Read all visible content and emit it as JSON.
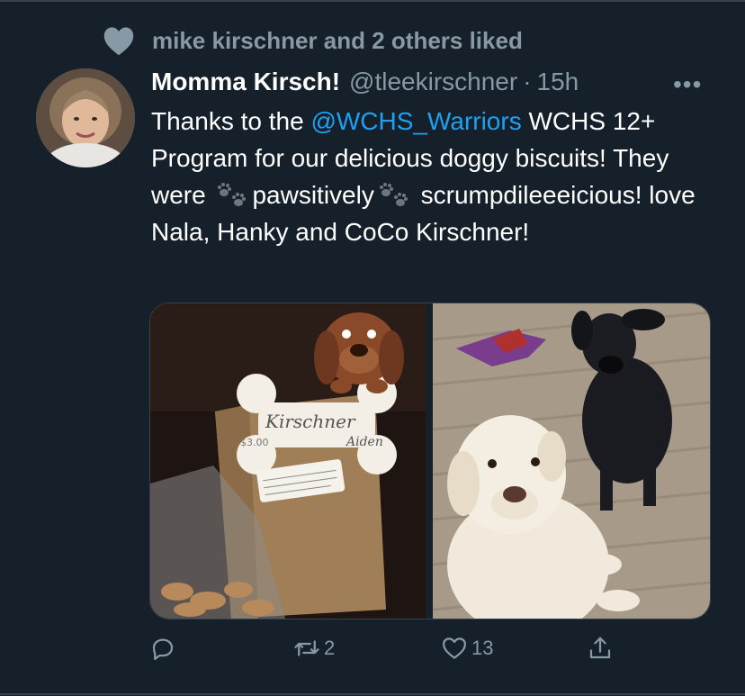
{
  "social_context": {
    "icon": "heart-icon",
    "text": "mike kirschner and 2 others liked"
  },
  "tweet": {
    "author": {
      "display_name": "Momma Kirsch!",
      "handle": "@tleekirschner",
      "separator": "·",
      "time": "15h"
    },
    "more_label": "•••",
    "text": {
      "part1": "Thanks to the ",
      "mention": "@WCHS_Warriors",
      "part2": " WCHS 12+ Program for our delicious doggy biscuits! They were ",
      "part3": "pawsitively",
      "part4": " scrumpdileeeicious! love Nala, Hanky and CoCo Kirschner!"
    },
    "media": {
      "image1": {
        "tag_name": "Kirschner",
        "price": "$3.00",
        "signed": "Aiden",
        "note": "Thank you from WCHS 12+ Program Baker: Aiden"
      }
    },
    "actions": {
      "reply_icon": "reply-icon",
      "retweet_icon": "retweet-icon",
      "retweet_count": "2",
      "like_icon": "heart-outline-icon",
      "like_count": "13",
      "share_icon": "share-icon"
    }
  },
  "colors": {
    "background": "#15202b",
    "secondary_text": "#8899a6",
    "link": "#1da1f2",
    "divider": "#38444d"
  }
}
